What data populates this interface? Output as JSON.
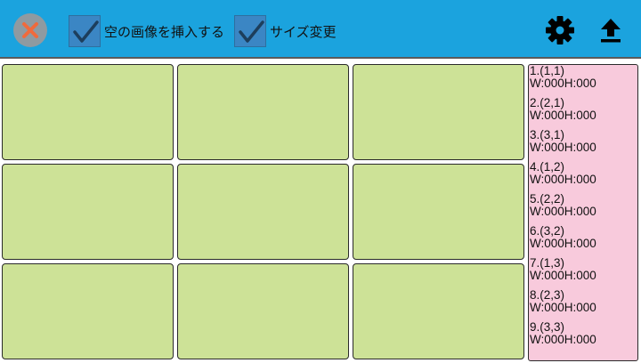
{
  "toolbar": {
    "close_icon": "close-circle-icon",
    "insert_empty_image": {
      "label": "空の画像を挿入する",
      "checked": true
    },
    "resize": {
      "label": "サイズ変更",
      "checked": true
    },
    "settings_icon": "gear-icon",
    "upload_icon": "upload-icon"
  },
  "colors": {
    "toolbar_bg": "#1ba3de",
    "cell_bg": "#cde297",
    "panel_bg": "#f8cadc",
    "checkbox_bg": "#3b86c4"
  },
  "grid": {
    "columns": 3,
    "rows": 3
  },
  "info_panel": {
    "items": [
      {
        "position": "1.(1,1)",
        "size": "W:000H:000"
      },
      {
        "position": "2.(2,1)",
        "size": "W:000H:000"
      },
      {
        "position": "3.(3,1)",
        "size": "W:000H:000"
      },
      {
        "position": "4.(1,2)",
        "size": "W:000H:000"
      },
      {
        "position": "5.(2,2)",
        "size": "W:000H:000"
      },
      {
        "position": "6.(3,2)",
        "size": "W:000H:000"
      },
      {
        "position": "7.(1,3)",
        "size": "W:000H:000"
      },
      {
        "position": "8.(2,3)",
        "size": "W:000H:000"
      },
      {
        "position": "9.(3,3)",
        "size": "W:000H:000"
      }
    ]
  }
}
